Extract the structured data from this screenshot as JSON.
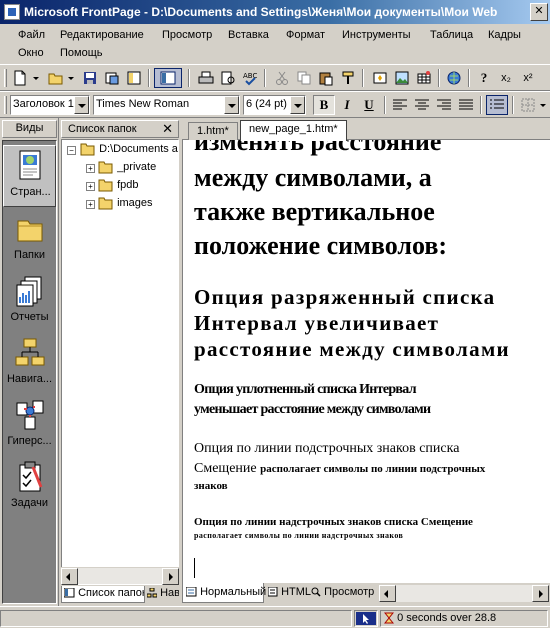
{
  "window": {
    "title": "Microsoft FrontPage - D:\\Documents and Settings\\Женя\\Мои документы\\Мои Web",
    "close_glyph": "✕"
  },
  "menu": {
    "items": [
      "Файл",
      "Редактирование",
      "Просмотр",
      "Вставка",
      "Формат",
      "Инструменты",
      "Таблица",
      "Кадры",
      "Окно",
      "Помощь"
    ]
  },
  "toolbar": {
    "style": "Заголовок 1",
    "font": "Times New Roman",
    "size": "6  (24 pt)",
    "bold": "B",
    "italic": "I",
    "underline": "U",
    "subscript": "x₂",
    "superscript": "x²",
    "help": "?"
  },
  "views": {
    "header": "Виды",
    "items": [
      "Стран...",
      "Папки",
      "Отчеты",
      "Навига...",
      "Гиперс...",
      "Задачи"
    ]
  },
  "folder_list": {
    "header": "Список папок",
    "close": "✕",
    "root": "D:\\Documents a",
    "children": [
      "_private",
      "fpdb",
      "images"
    ],
    "tabs": [
      "Список папок",
      "Нав"
    ]
  },
  "tabs": [
    "1.htm*",
    "new_page_1.htm*"
  ],
  "document": {
    "heading1_lines": [
      "изменять расстояние",
      "между символами, а",
      "также вертикальное",
      "положение символов:"
    ],
    "heading2_lines": [
      "Опция разряженный списка",
      "Интервал увеличивает",
      "расстояние между символами"
    ],
    "heading3_lines": [
      "Опция уплотненный списка Интервал",
      "уменьшает расстояние между символами"
    ],
    "para1_line1": "Опция по линии подстрочных  знаков списка",
    "para1_line2": "Смещение",
    "para1_small_a": "располагает символы по линии подстрочных",
    "para1_small_b": "знаков",
    "para2_line1": "Опция по линии надстрочных  знаков списка Смещение",
    "para2_small": "располагает символы  по линии  надстрочных знаков"
  },
  "view_tabs": [
    "Нормальный",
    "HTML",
    "Просмотр"
  ],
  "status": {
    "time": "0 seconds over 28.8"
  }
}
